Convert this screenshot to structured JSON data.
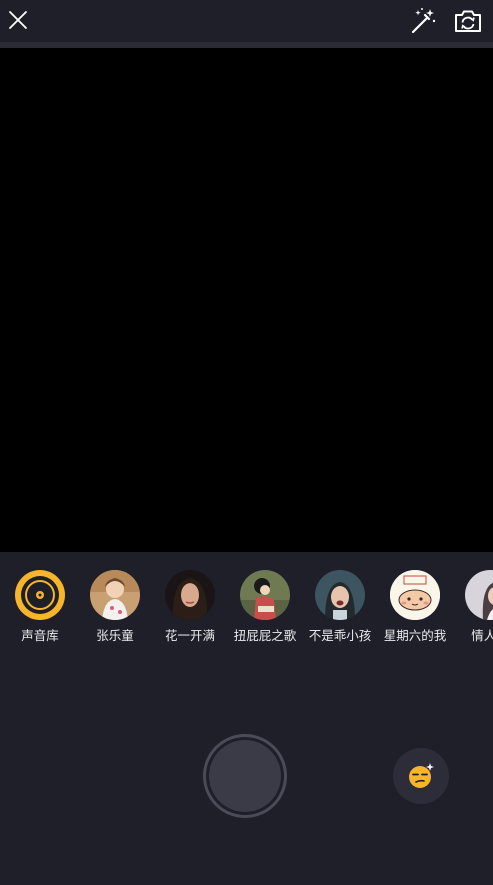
{
  "topbar": {
    "close_icon": "close-icon",
    "magic_icon": "magic-wand-icon",
    "flip_icon": "camera-flip-icon"
  },
  "music": {
    "items": [
      {
        "label": "声音库",
        "kind": "library"
      },
      {
        "label": "张乐童",
        "kind": "avatar"
      },
      {
        "label": "花一开满",
        "kind": "avatar"
      },
      {
        "label": "扭屁屁之歌",
        "kind": "avatar"
      },
      {
        "label": "不是乖小孩",
        "kind": "avatar"
      },
      {
        "label": "星期六的我",
        "kind": "avatar"
      },
      {
        "label": "情人节",
        "kind": "avatar"
      }
    ]
  },
  "controls": {
    "shutter_icon": "record-button",
    "emoji_icon": "sticker-emoji-icon"
  },
  "colors": {
    "background": "#1e1f29",
    "accent": "#f7b52b",
    "text": "#e9e9ee"
  }
}
